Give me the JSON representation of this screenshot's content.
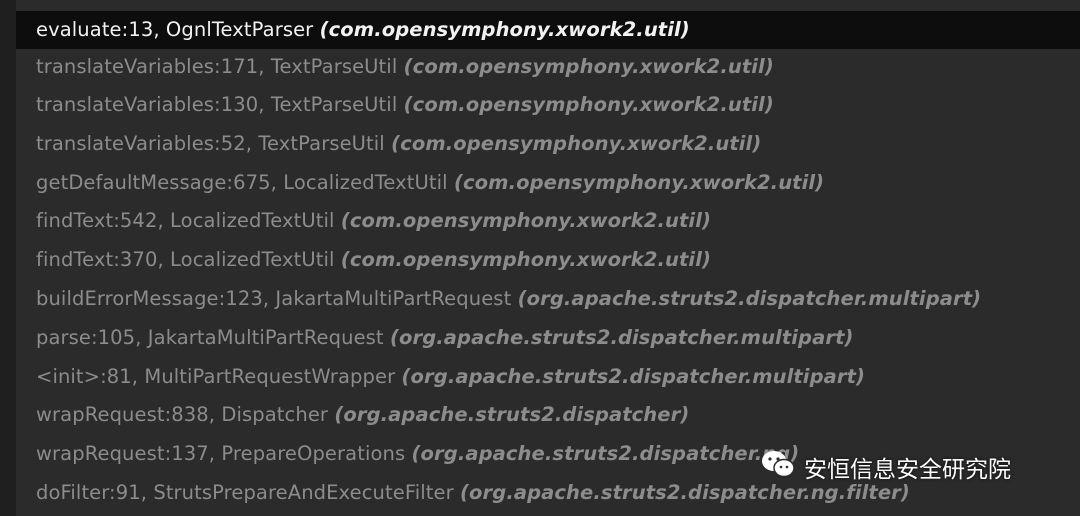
{
  "stack_frames": [
    {
      "method": "evaluate:13, OgnlTextParser",
      "package": "(com.opensymphony.xwork2.util)",
      "selected": true
    },
    {
      "method": "translateVariables:171, TextParseUtil",
      "package": "(com.opensymphony.xwork2.util)",
      "selected": false
    },
    {
      "method": "translateVariables:130, TextParseUtil",
      "package": "(com.opensymphony.xwork2.util)",
      "selected": false
    },
    {
      "method": "translateVariables:52, TextParseUtil",
      "package": "(com.opensymphony.xwork2.util)",
      "selected": false
    },
    {
      "method": "getDefaultMessage:675, LocalizedTextUtil",
      "package": "(com.opensymphony.xwork2.util)",
      "selected": false
    },
    {
      "method": "findText:542, LocalizedTextUtil",
      "package": "(com.opensymphony.xwork2.util)",
      "selected": false
    },
    {
      "method": "findText:370, LocalizedTextUtil",
      "package": "(com.opensymphony.xwork2.util)",
      "selected": false
    },
    {
      "method": "buildErrorMessage:123, JakartaMultiPartRequest",
      "package": "(org.apache.struts2.dispatcher.multipart)",
      "selected": false
    },
    {
      "method": "parse:105, JakartaMultiPartRequest",
      "package": "(org.apache.struts2.dispatcher.multipart)",
      "selected": false
    },
    {
      "method": "<init>:81, MultiPartRequestWrapper",
      "package": "(org.apache.struts2.dispatcher.multipart)",
      "selected": false
    },
    {
      "method": "wrapRequest:838, Dispatcher",
      "package": "(org.apache.struts2.dispatcher)",
      "selected": false
    },
    {
      "method": "wrapRequest:137, PrepareOperations",
      "package": "(org.apache.struts2.dispatcher.ng)",
      "selected": false
    },
    {
      "method": "doFilter:91, StrutsPrepareAndExecuteFilter",
      "package": "(org.apache.struts2.dispatcher.ng.filter)",
      "selected": false
    }
  ],
  "watermark": {
    "icon": "wechat-icon",
    "text": "安恒信息安全研究院"
  },
  "colors": {
    "background": "#2b2b2b",
    "selected_background": "#0d0d0d",
    "selected_text": "#f2f2f2",
    "frame_text": "#8c8c8c"
  }
}
